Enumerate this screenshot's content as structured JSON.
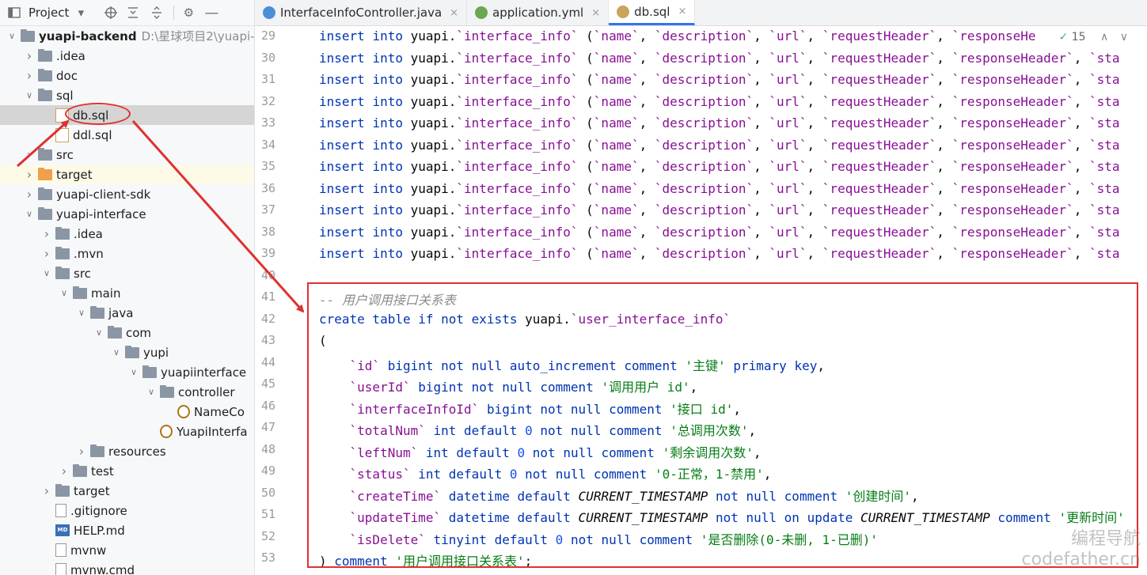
{
  "project_panel": {
    "title": "Project",
    "tree": [
      {
        "label": "yuapi-backend",
        "path": "D:\\星球项目2\\yuapi-",
        "type": "module",
        "indent": 0,
        "expanded": true,
        "bold": true
      },
      {
        "label": ".idea",
        "type": "folder",
        "indent": 1,
        "expanded": false
      },
      {
        "label": "doc",
        "type": "folder",
        "indent": 1,
        "expanded": false
      },
      {
        "label": "sql",
        "type": "folder",
        "indent": 1,
        "expanded": true
      },
      {
        "label": "db.sql",
        "type": "sql",
        "indent": 2,
        "selected": true
      },
      {
        "label": "ddl.sql",
        "type": "sql",
        "indent": 2
      },
      {
        "label": "src",
        "type": "folder",
        "indent": 1,
        "expanded": false
      },
      {
        "label": "target",
        "type": "folder-orange",
        "indent": 1,
        "expanded": false,
        "highlighted": true
      },
      {
        "label": "yuapi-client-sdk",
        "type": "module",
        "indent": 1,
        "expanded": false
      },
      {
        "label": "yuapi-interface",
        "type": "module",
        "indent": 1,
        "expanded": true
      },
      {
        "label": ".idea",
        "type": "folder",
        "indent": 2,
        "expanded": false
      },
      {
        "label": ".mvn",
        "type": "folder",
        "indent": 2,
        "expanded": false
      },
      {
        "label": "src",
        "type": "folder",
        "indent": 2,
        "expanded": true
      },
      {
        "label": "main",
        "type": "folder",
        "indent": 3,
        "expanded": true
      },
      {
        "label": "java",
        "type": "folder",
        "indent": 4,
        "expanded": true
      },
      {
        "label": "com",
        "type": "folder",
        "indent": 5,
        "expanded": true
      },
      {
        "label": "yupi",
        "type": "folder",
        "indent": 6,
        "expanded": true
      },
      {
        "label": "yuapiinterface",
        "type": "folder",
        "indent": 7,
        "expanded": true
      },
      {
        "label": "controller",
        "type": "folder",
        "indent": 8,
        "expanded": true
      },
      {
        "label": "NameCo",
        "type": "java",
        "indent": 9
      },
      {
        "label": "YuapiInterfa",
        "type": "java",
        "indent": 8
      },
      {
        "label": "resources",
        "type": "folder",
        "indent": 4,
        "expanded": false
      },
      {
        "label": "test",
        "type": "folder",
        "indent": 3,
        "expanded": false
      },
      {
        "label": "target",
        "type": "folder",
        "indent": 2,
        "expanded": false
      },
      {
        "label": ".gitignore",
        "type": "file",
        "indent": 2
      },
      {
        "label": "HELP.md",
        "type": "md",
        "indent": 2
      },
      {
        "label": "mvnw",
        "type": "file",
        "indent": 2
      },
      {
        "label": "mvnw.cmd",
        "type": "file",
        "indent": 2
      }
    ]
  },
  "tabs": [
    {
      "label": "InterfaceInfoController.java",
      "icon": "java-class-icon",
      "color": "#4a8fd6",
      "active": false
    },
    {
      "label": "application.yml",
      "icon": "spring-yml-icon",
      "color": "#6aa84f",
      "active": false
    },
    {
      "label": "db.sql",
      "icon": "sql-file-icon",
      "color": "#c9a45b",
      "active": true
    }
  ],
  "editor": {
    "analysis_count": "15",
    "line_numbers": [
      "29",
      "30",
      "31",
      "32",
      "33",
      "34",
      "35",
      "36",
      "37",
      "38",
      "39",
      "40",
      "41",
      "42",
      "43",
      "44",
      "45",
      "46",
      "47",
      "48",
      "49",
      "50",
      "51",
      "52",
      "53"
    ],
    "insert_line": {
      "kw1": "insert",
      "kw2": "into",
      "table": "yuapi.",
      "table_name": "`interface_info`",
      "open": " (",
      "columns": [
        "`name`",
        "`description`",
        "`url`",
        "`requestHeader`",
        "`responseHeader`",
        "`sta"
      ],
      "columns_first": [
        "`name`",
        "`description`",
        "`url`",
        "`requestHeader`",
        "`responseHe"
      ]
    },
    "create_block": {
      "comment": "-- 用户调用接口关系表",
      "create": "create table if not exists",
      "table": "yuapi.",
      "table_name": "`user_interface_info`",
      "open_paren": "(",
      "columns": [
        {
          "name": "`id`",
          "def": " bigint not null auto_increment comment ",
          "comment": "'主键'",
          "tail": " primary key",
          "end": ","
        },
        {
          "name": "`userId`",
          "def": " bigint not null comment ",
          "comment": "'调用用户 id'",
          "tail": "",
          "end": ","
        },
        {
          "name": "`interfaceInfoId`",
          "def": " bigint not null comment ",
          "comment": "'接口 id'",
          "tail": "",
          "end": ","
        },
        {
          "name": "`totalNum`",
          "def": " int default ",
          "num": "0",
          "def2": " not null comment ",
          "comment": "'总调用次数'",
          "end": ","
        },
        {
          "name": "`leftNum`",
          "def": " int default ",
          "num": "0",
          "def2": " not null comment ",
          "comment": "'剩余调用次数'",
          "end": ","
        },
        {
          "name": "`status`",
          "def": " int default ",
          "num": "0",
          "def2": " not null comment ",
          "comment": "'0-正常，1-禁用'",
          "end": ","
        },
        {
          "name": "`createTime`",
          "def": " datetime default ",
          "ts": "CURRENT_TIMESTAMP",
          "def2": " not null comment ",
          "comment": "'创建时间'",
          "end": ","
        },
        {
          "name": "`updateTime`",
          "def": " datetime default ",
          "ts": "CURRENT_TIMESTAMP",
          "def2": " not null on update ",
          "ts2": "CURRENT_TIMESTAMP",
          "def3": " comment ",
          "comment": "'更新时间'",
          "end": ""
        },
        {
          "name": "`isDelete`",
          "def": " tinyint default ",
          "num": "0",
          "def2": " not null comment ",
          "comment": "'是否删除(0-未删, 1-已删)'",
          "end": ""
        }
      ],
      "close": ") comment ",
      "close_comment": "'用户调用接口关系表'",
      "close_end": ";"
    }
  },
  "watermark": {
    "line1": "编程导航",
    "line2": "codefather.cn"
  },
  "colors": {
    "annotation": "#e03030",
    "keyword": "#0033b3",
    "identifier": "#871094",
    "string": "#067d17"
  }
}
